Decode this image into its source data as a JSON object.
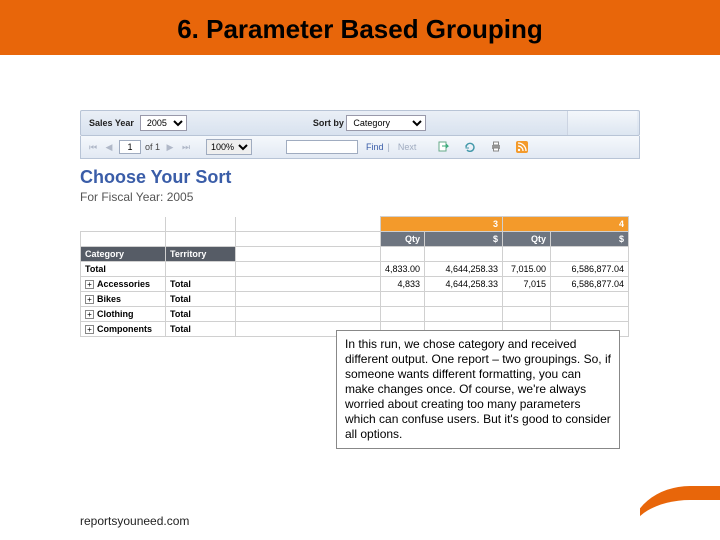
{
  "slide": {
    "title": "6. Parameter Based Grouping",
    "footer": "reportsyouneed.com"
  },
  "params": {
    "sales_year_label": "Sales Year",
    "sales_year_value": "2005",
    "sort_by_label": "Sort by",
    "sort_by_value": "Category"
  },
  "nav": {
    "page_current": "1",
    "page_of": "of 1",
    "zoom": "100%",
    "find_placeholder": "",
    "find_label": "Find",
    "next_label": "Next"
  },
  "report": {
    "heading": "Choose Your Sort",
    "subheading": "For Fiscal Year: 2005",
    "period_cols": [
      "3",
      "4"
    ],
    "metric_cols": [
      "Qty",
      "$",
      "Qty",
      "$"
    ],
    "cat_header": "Category",
    "terr_header": "Territory",
    "total_label": "Total",
    "total_row": {
      "qty3": "4,833.00",
      "amt3": "4,644,258.33",
      "qty4": "7,015.00",
      "amt4": "6,586,877.04"
    },
    "rows": [
      {
        "label": "Accessories",
        "sub": "Total",
        "qty3": "4,833",
        "amt3": "4,644,258.33",
        "qty4": "7,015",
        "amt4": "6,586,877.04"
      },
      {
        "label": "Bikes",
        "sub": "Total"
      },
      {
        "label": "Clothing",
        "sub": "Total"
      },
      {
        "label": "Components",
        "sub": "Total"
      }
    ]
  },
  "callout": {
    "text": "In this run, we chose category and received different output. One report – two groupings.  So, if someone wants different formatting, you can make changes once.  Of course, we're always worried about creating too many parameters which can confuse users.  But it's good to consider all options."
  }
}
